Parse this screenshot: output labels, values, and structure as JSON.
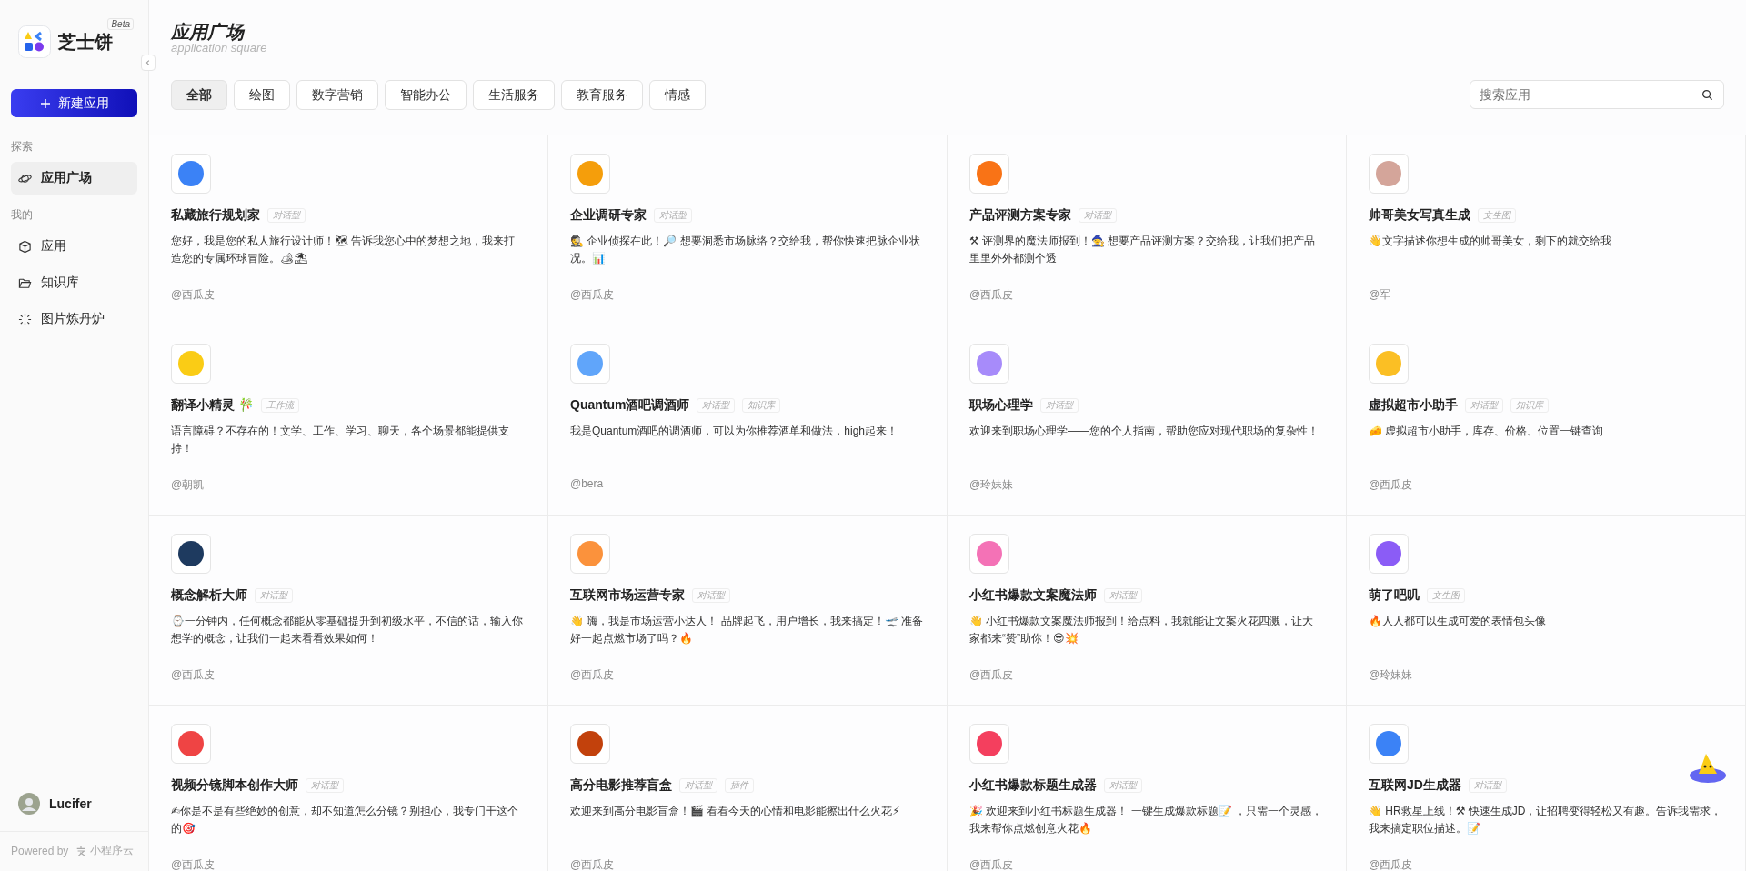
{
  "sidebar": {
    "brand": "芝士饼",
    "badge": "Beta",
    "new_button": "新建应用",
    "sections": [
      {
        "label": "探索",
        "items": [
          {
            "label": "应用广场",
            "selected": true
          }
        ]
      },
      {
        "label": "我的",
        "items": [
          {
            "label": "应用",
            "selected": false
          },
          {
            "label": "知识库",
            "selected": false
          },
          {
            "label": "图片炼丹炉",
            "selected": false
          }
        ]
      }
    ],
    "user": "Lucifer",
    "footer": {
      "prefix": "Powered by",
      "brand": "小程序云"
    }
  },
  "header": {
    "title": "应用广场",
    "subtitle": "application square"
  },
  "tabs": [
    {
      "label": "全部",
      "selected": true
    },
    {
      "label": "绘图",
      "selected": false
    },
    {
      "label": "数字营销",
      "selected": false
    },
    {
      "label": "智能办公",
      "selected": false
    },
    {
      "label": "生活服务",
      "selected": false
    },
    {
      "label": "教育服务",
      "selected": false
    },
    {
      "label": "情感",
      "selected": false
    }
  ],
  "search": {
    "placeholder": "搜索应用"
  },
  "apps": [
    {
      "name": "私藏旅行规划家",
      "tags": [
        "对话型"
      ],
      "description": "您好，我是您的私人旅行设计师！🗺 告诉我您心中的梦想之地，我来打造您的专属环球冒险。🏕⛱",
      "author": "@西瓜皮"
    },
    {
      "name": "企业调研专家",
      "tags": [
        "对话型"
      ],
      "description": "🕵 企业侦探在此！🔎 想要洞悉市场脉络？交给我，帮你快速把脉企业状况。📊",
      "author": "@西瓜皮"
    },
    {
      "name": "产品评测方案专家",
      "tags": [
        "对话型"
      ],
      "description": "⚒ 评测界的魔法师报到！🧙 想要产品评测方案？交给我，让我们把产品里里外外都测个透",
      "author": "@西瓜皮"
    },
    {
      "name": "帅哥美女写真生成",
      "tags": [
        "文生图"
      ],
      "description": "👋文字描述你想生成的帅哥美女，剩下的就交给我",
      "author": "@军"
    },
    {
      "name": "翻译小精灵 🎋",
      "tags": [
        "工作流"
      ],
      "description": "语言障碍？不存在的！文学、工作、学习、聊天，各个场景都能提供支持！",
      "author": "@朝凯"
    },
    {
      "name": "Quantum酒吧调酒师",
      "tags": [
        "对话型",
        "知识库"
      ],
      "description": "我是Quantum酒吧的调酒师，可以为你推荐酒单和做法，high起来！",
      "author": "@bera"
    },
    {
      "name": "职场心理学",
      "tags": [
        "对话型"
      ],
      "description": "欢迎来到职场心理学——您的个人指南，帮助您应对现代职场的复杂性！",
      "author": "@玲妹妹"
    },
    {
      "name": "虚拟超市小助手",
      "tags": [
        "对话型",
        "知识库"
      ],
      "description": "🧀 虚拟超市小助手，库存、价格、位置一键查询",
      "author": "@西瓜皮"
    },
    {
      "name": "概念解析大师",
      "tags": [
        "对话型"
      ],
      "description": "⌚一分钟内，任何概念都能从零基础提升到初级水平，不信的话，输入你想学的概念，让我们一起来看看效果如何！",
      "author": "@西瓜皮"
    },
    {
      "name": "互联网市场运营专家",
      "tags": [
        "对话型"
      ],
      "description": "👋 嗨，我是市场运营小达人！ 品牌起飞，用户增长，我来搞定！🛫 准备好一起点燃市场了吗？🔥",
      "author": "@西瓜皮"
    },
    {
      "name": "小红书爆款文案魔法师",
      "tags": [
        "对话型"
      ],
      "description": "👋 小红书爆款文案魔法师报到！给点料，我就能让文案火花四溅，让大家都来“赞”助你！😎💥",
      "author": "@西瓜皮"
    },
    {
      "name": "萌了吧叽",
      "tags": [
        "文生图"
      ],
      "description": "🔥人人都可以生成可爱的表情包头像",
      "author": "@玲妹妹"
    },
    {
      "name": "视频分镜脚本创作大师",
      "tags": [
        "对话型"
      ],
      "description": "✍你是不是有些绝妙的创意，却不知道怎么分镜？别担心，我专门干这个的🎯",
      "author": "@西瓜皮"
    },
    {
      "name": "高分电影推荐盲盒",
      "tags": [
        "对话型",
        "插件"
      ],
      "description": "欢迎来到高分电影盲盒！🎬 看看今天的心情和电影能擦出什么火花⚡",
      "author": "@西瓜皮"
    },
    {
      "name": "小红书爆款标题生成器",
      "tags": [
        "对话型"
      ],
      "description": "🎉 欢迎来到小红书标题生成器！ 一键生成爆款标题📝 ，只需一个灵感，我来帮你点燃创意火花🔥",
      "author": "@西瓜皮"
    },
    {
      "name": "互联网JD生成器",
      "tags": [
        "对话型"
      ],
      "description": "👋 HR救星上线！⚒ 快速生成JD，让招聘变得轻松又有趣。告诉我需求，我来搞定职位描述。📝",
      "author": "@西瓜皮"
    }
  ]
}
